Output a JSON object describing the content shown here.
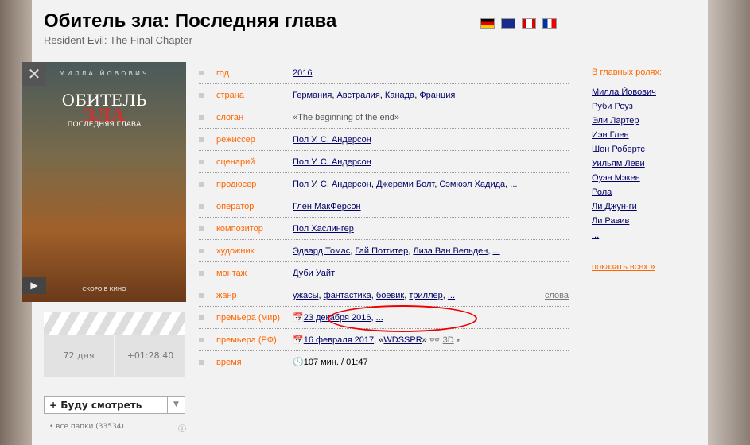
{
  "title": "Обитель зла: Последняя глава",
  "original_title": "Resident Evil: The Final Chapter",
  "flags": [
    "de",
    "au",
    "ca",
    "fr"
  ],
  "poster": {
    "actor": "МИЛЛА ЙОВОВИЧ",
    "title1": "ОБИТЕЛЬ",
    "title2": "ЗЛА",
    "subtitle": "ПОСЛЕДНЯЯ ГЛАВА",
    "soon": "СКОРО В КИНО"
  },
  "countdown": {
    "days": "72 дня",
    "time": "+01:28:40"
  },
  "watch": {
    "label": "+ Буду смотреть",
    "folders": "• все папки (33534)"
  },
  "rows": [
    {
      "key": "год",
      "values": [
        "2016"
      ]
    },
    {
      "key": "страна",
      "values": [
        "Германия",
        "Австралия",
        "Канада",
        "Франция"
      ]
    },
    {
      "key": "слоган",
      "text": "«The beginning of the end»"
    },
    {
      "key": "режиссер",
      "values": [
        "Пол У. С. Андерсон"
      ]
    },
    {
      "key": "сценарий",
      "values": [
        "Пол У. С. Андерсон"
      ]
    },
    {
      "key": "продюсер",
      "values": [
        "Пол У. С. Андерсон",
        "Джереми Болт",
        "Сэмюэл Хадида",
        "..."
      ]
    },
    {
      "key": "оператор",
      "values": [
        "Глен МакФерсон"
      ]
    },
    {
      "key": "композитор",
      "values": [
        "Пол Хаслингер"
      ]
    },
    {
      "key": "художник",
      "values": [
        "Эдвард Томас",
        "Гай Потгитер",
        "Лиза Ван Вельден",
        "..."
      ]
    },
    {
      "key": "монтаж",
      "values": [
        "Дуби Уайт"
      ]
    },
    {
      "key": "жанр",
      "values": [
        "ужасы",
        "фантастика",
        "боевик",
        "триллер",
        "..."
      ],
      "extra": "слова"
    },
    {
      "key": "премьера (мир)",
      "values": [
        "23 декабря 2016",
        "..."
      ],
      "icon": "calendar"
    },
    {
      "key": "премьера (РФ)",
      "values": [
        "16 февраля 2017"
      ],
      "icon": "calendar",
      "distributor": "WDSSPR",
      "format": "3D"
    },
    {
      "key": "время",
      "text": "107 мин. / 01:47",
      "icon": "clock"
    }
  ],
  "cast": {
    "heading": "В главных ролях:",
    "actors": [
      "Милла Йовович",
      "Руби Роуз",
      "Эли Лартер",
      "Иэн Глен",
      "Шон Робертс",
      "Уильям Леви",
      "Оуэн Мэкен",
      "Рола",
      "Ли Джун-ги",
      "Ли Равив",
      "..."
    ],
    "show_all": "показать всех »"
  }
}
